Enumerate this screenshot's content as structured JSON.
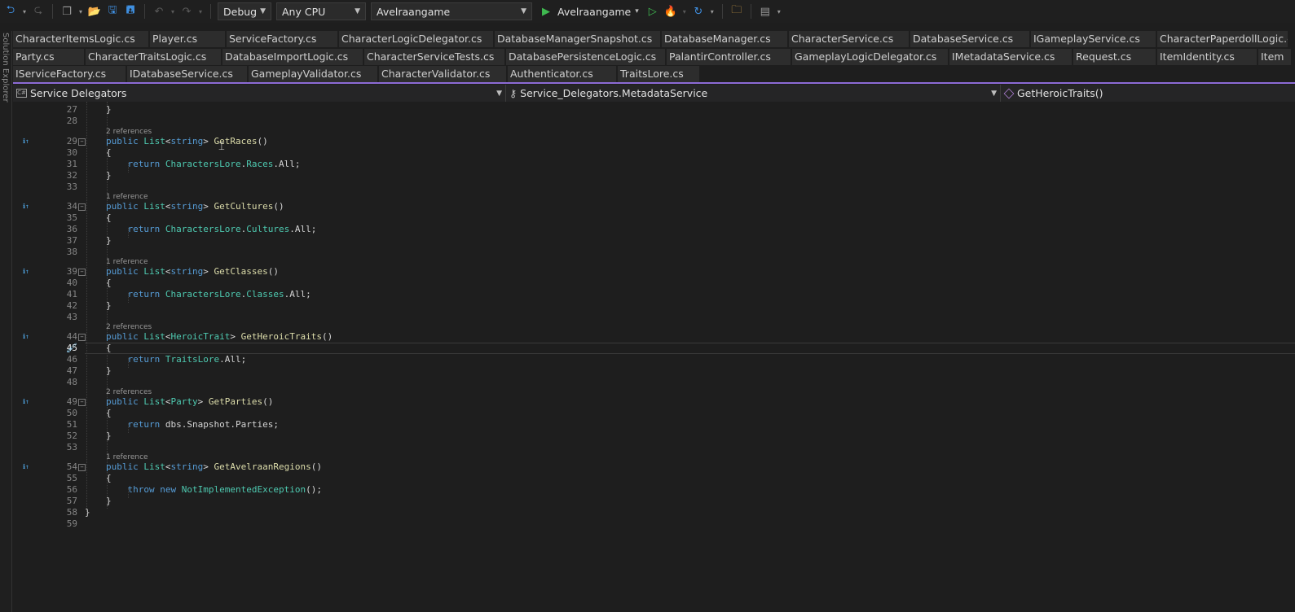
{
  "toolbar": {
    "config": "Debug",
    "platform": "Any CPU",
    "startup_project": "Avelraangame",
    "run_label": "Avelraangame"
  },
  "tabs": {
    "row1": [
      "CharacterItemsLogic.cs",
      "Player.cs",
      "ServiceFactory.cs",
      "CharacterLogicDelegator.cs",
      "DatabaseManagerSnapshot.cs",
      "DatabaseManager.cs",
      "CharacterService.cs",
      "DatabaseService.cs",
      "IGameplayService.cs",
      "CharacterPaperdollLogic.cs"
    ],
    "row2": [
      "Party.cs",
      "CharacterTraitsLogic.cs",
      "DatabaseImportLogic.cs",
      "CharacterServiceTests.cs",
      "DatabasePersistenceLogic.cs",
      "PalantirController.cs",
      "GameplayLogicDelegator.cs",
      "IMetadataService.cs",
      "Request.cs",
      "ItemIdentity.cs",
      "Item"
    ],
    "row3": [
      "IServiceFactory.cs",
      "IDatabaseService.cs",
      "GameplayValidator.cs",
      "CharacterValidator.cs",
      "Authenticator.cs",
      "TraitsLore.cs"
    ]
  },
  "side_panel": {
    "label": "Solution Explorer"
  },
  "navbar": {
    "project": "Service Delegators",
    "type": "Service_Delegators.MetadataService",
    "member": "GetHeroicTraits()"
  },
  "editor": {
    "active_line": "45",
    "refs": {
      "r29": "2 references",
      "r34": "1 reference",
      "r39": "1 reference",
      "r44": "2 references",
      "r49": "2 references",
      "r54": "1 reference"
    },
    "line_numbers": [
      "27",
      "28",
      "29",
      "30",
      "31",
      "32",
      "33",
      "34",
      "35",
      "36",
      "37",
      "38",
      "39",
      "40",
      "41",
      "42",
      "43",
      "44",
      "45",
      "46",
      "47",
      "48",
      "49",
      "50",
      "51",
      "52",
      "53",
      "54",
      "55",
      "56",
      "57",
      "58",
      "59"
    ],
    "code": {
      "l27": "}",
      "l29_kw": "public",
      "l29_type": "List",
      "l29_gen": "string",
      "l29_fn": "GetRaces",
      "l31_kw": "return",
      "l31_obj": "CharactersLore",
      "l31_prop": "Races",
      "l31_all": "All",
      "l34_fn": "GetCultures",
      "l36_prop": "Cultures",
      "l39_fn": "GetClasses",
      "l41_prop": "Classes",
      "l44_gen": "HeroicTrait",
      "l44_fn": "GetHeroicTraits",
      "l46_obj": "TraitsLore",
      "l49_gen": "Party",
      "l49_fn": "GetParties",
      "l51_expr": "dbs.Snapshot.Parties",
      "l54_fn": "GetAvelraanRegions",
      "l56_throw": "throw",
      "l56_new": "new",
      "l56_exc": "NotImplementedException"
    }
  },
  "colors": {
    "keyword": "#569cd6",
    "type": "#4ec9b0",
    "method": "#dcdcaa",
    "tab_accent": "#8c6bd6",
    "background": "#1e1e1e"
  }
}
